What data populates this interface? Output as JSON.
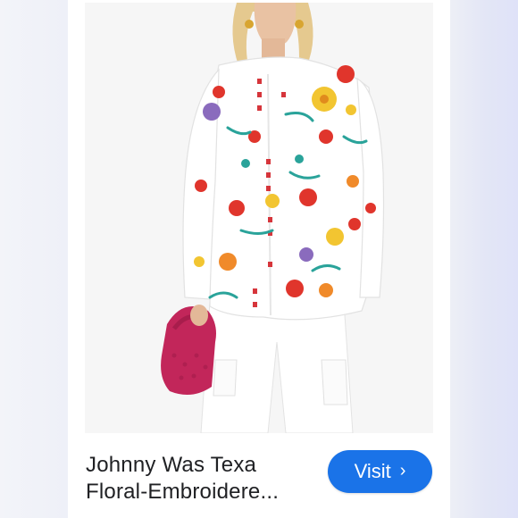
{
  "product": {
    "title_line1": "Johnny Was Texa",
    "title_line2": "Floral-Embroidere...",
    "image_alt": "White floral-embroidered tunic blouse with pink handbag"
  },
  "visit_button": {
    "label": "Visit",
    "icon": "chevron-right-icon"
  },
  "colors": {
    "visit_bg": "#1a73e8",
    "title_text": "#202124"
  }
}
